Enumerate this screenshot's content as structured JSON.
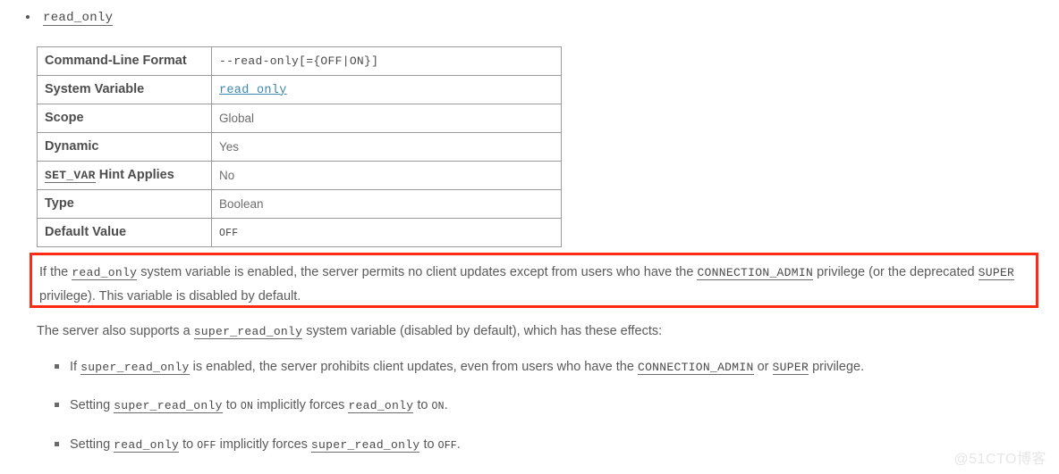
{
  "top_item": {
    "label": "read_only"
  },
  "properties_table": {
    "rows": [
      {
        "key": "Command-Line Format",
        "key_code_prefix": "",
        "value": "--read-only[={OFF|ON}]",
        "value_style": "code-plain"
      },
      {
        "key": "System Variable",
        "key_code_prefix": "",
        "value": "read_only",
        "value_style": "code-link"
      },
      {
        "key": "Scope",
        "key_code_prefix": "",
        "value": "Global",
        "value_style": "text"
      },
      {
        "key": "Dynamic",
        "key_code_prefix": "",
        "value": "Yes",
        "value_style": "text"
      },
      {
        "key": "Hint Applies",
        "key_code_prefix": "SET_VAR",
        "value": "No",
        "value_style": "text"
      },
      {
        "key": "Type",
        "key_code_prefix": "",
        "value": "Boolean",
        "value_style": "text"
      },
      {
        "key": "Default Value",
        "key_code_prefix": "",
        "value": "OFF",
        "value_style": "smallcaps"
      }
    ]
  },
  "highlight": {
    "border_color": "#ff2a14",
    "line1_part1": "If the ",
    "line1_code1": "read_only",
    "line1_part2": " system variable is enabled, the server permits no client updates except from users who have the ",
    "line1_code2": "CONNECTION_ADMIN",
    "line1_part3": " privilege (or the deprecated ",
    "line2_code1": "SUPER",
    "line2_part1": " privilege). This variable is disabled by default."
  },
  "body_paragraph": {
    "part1": "The server also supports a ",
    "code1": "super_read_only",
    "part2": " system variable (disabled by default), which has these effects:"
  },
  "effects": [
    {
      "part1": "If ",
      "code1": "super_read_only",
      "part2": " is enabled, the server prohibits client updates, even from users who have the ",
      "code2": "CONNECTION_ADMIN",
      "part3": " or ",
      "code3": "SUPER",
      "part4": " privilege."
    },
    {
      "part1": "Setting ",
      "code1": "super_read_only",
      "part2": " to ",
      "sc1": "ON",
      "part3": " implicitly forces ",
      "code2": "read_only",
      "part4": " to ",
      "sc2": "ON",
      "part5": "."
    },
    {
      "part1": "Setting ",
      "code1": "read_only",
      "part2": " to ",
      "sc1": "OFF",
      "part3": " implicitly forces ",
      "code2": "super_read_only",
      "part4": " to ",
      "sc2": "OFF",
      "part5": "."
    }
  ],
  "watermark": {
    "text": "@51CTO博客"
  },
  "colors": {
    "link": "#3b87ad",
    "text": "#5a5a5a",
    "table_border": "#9b9b9b",
    "highlight_border": "#ff2a14"
  }
}
